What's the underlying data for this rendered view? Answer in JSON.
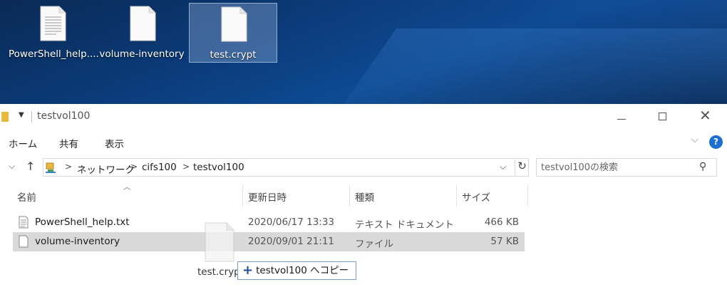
{
  "desktop": {
    "icons": [
      {
        "label": "PowerShell_help...."
      },
      {
        "label": "volume-inventory"
      },
      {
        "label": "test.crypt"
      }
    ]
  },
  "window": {
    "title": "testvol100",
    "ribbon_tabs": [
      "ホーム",
      "共有",
      "表示"
    ],
    "address": {
      "crumbs": [
        "ネットワーク",
        "cifs100",
        "testvol100"
      ]
    },
    "search": {
      "placeholder": "testvol100の検索"
    },
    "columns": {
      "name": "名前",
      "date": "更新日時",
      "type": "種類",
      "size": "サイズ"
    },
    "files": [
      {
        "name": "PowerShell_help.txt",
        "date": "2020/06/17 13:33",
        "type": "テキスト ドキュメント",
        "size": "466 KB"
      },
      {
        "name": "volume-inventory",
        "date": "2020/09/01 21:11",
        "type": "ファイル",
        "size": "57 KB"
      }
    ]
  },
  "drag": {
    "file_label": "test.cryp",
    "tooltip": "testvol100 へコピー"
  },
  "colors": {
    "selection": "#d9d9d9",
    "help_button": "#1a6fd0",
    "folder": "#e8b93a"
  }
}
